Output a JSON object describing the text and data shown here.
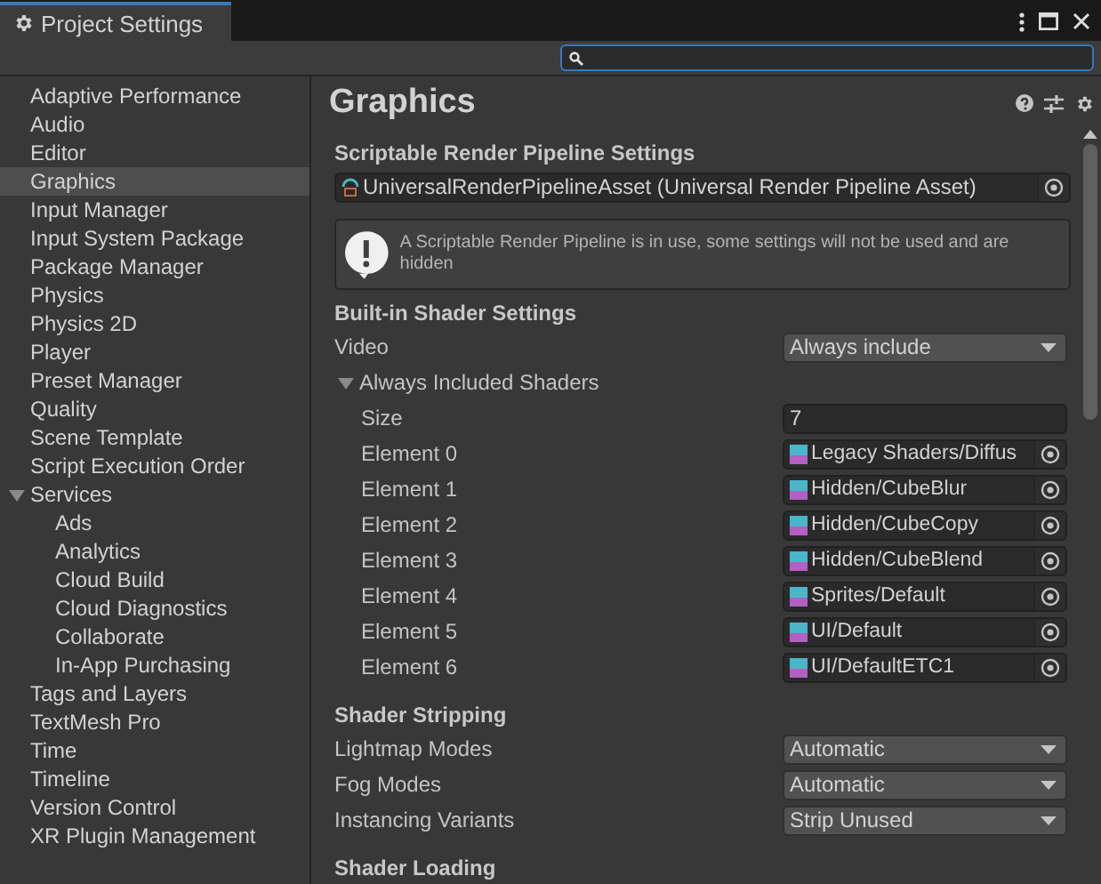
{
  "window": {
    "title": "Project Settings"
  },
  "sidebar": {
    "items": [
      {
        "label": "Adaptive Performance",
        "selected": false
      },
      {
        "label": "Audio",
        "selected": false
      },
      {
        "label": "Editor",
        "selected": false
      },
      {
        "label": "Graphics",
        "selected": true
      },
      {
        "label": "Input Manager",
        "selected": false
      },
      {
        "label": "Input System Package",
        "selected": false
      },
      {
        "label": "Package Manager",
        "selected": false
      },
      {
        "label": "Physics",
        "selected": false
      },
      {
        "label": "Physics 2D",
        "selected": false
      },
      {
        "label": "Player",
        "selected": false
      },
      {
        "label": "Preset Manager",
        "selected": false
      },
      {
        "label": "Quality",
        "selected": false
      },
      {
        "label": "Scene Template",
        "selected": false
      },
      {
        "label": "Script Execution Order",
        "selected": false
      },
      {
        "label": "Services",
        "selected": false,
        "expanded": true,
        "children": [
          {
            "label": "Ads",
            "selected": false
          },
          {
            "label": "Analytics",
            "selected": false
          },
          {
            "label": "Cloud Build",
            "selected": false
          },
          {
            "label": "Cloud Diagnostics",
            "selected": false
          },
          {
            "label": "Collaborate",
            "selected": false
          },
          {
            "label": "In-App Purchasing",
            "selected": false
          }
        ]
      },
      {
        "label": "Tags and Layers",
        "selected": false
      },
      {
        "label": "TextMesh Pro",
        "selected": false
      },
      {
        "label": "Time",
        "selected": false
      },
      {
        "label": "Timeline",
        "selected": false
      },
      {
        "label": "Version Control",
        "selected": false
      },
      {
        "label": "XR Plugin Management",
        "selected": false
      }
    ]
  },
  "panel": {
    "title": "Graphics",
    "sections": [
      {
        "heading": "Scriptable Render Pipeline Settings",
        "rows": [
          {
            "kind": "asset",
            "value": "UniversalRenderPipelineAsset (Universal Render Pipeline Asset)"
          },
          {
            "kind": "warning",
            "text": "A Scriptable Render Pipeline is in use, some settings will not be used and are hidden"
          }
        ]
      },
      {
        "heading": "Built-in Shader Settings",
        "rows": [
          {
            "kind": "dropdown",
            "label": "Video",
            "value": "Always include"
          },
          {
            "kind": "foldout",
            "label": "Always Included Shaders",
            "expanded": true,
            "children": [
              {
                "kind": "number",
                "label": "Size",
                "value": "7"
              },
              {
                "kind": "object",
                "label": "Element 0",
                "value": "Legacy Shaders/Diffus"
              },
              {
                "kind": "object",
                "label": "Element 1",
                "value": "Hidden/CubeBlur"
              },
              {
                "kind": "object",
                "label": "Element 2",
                "value": "Hidden/CubeCopy"
              },
              {
                "kind": "object",
                "label": "Element 3",
                "value": "Hidden/CubeBlend"
              },
              {
                "kind": "object",
                "label": "Element 4",
                "value": "Sprites/Default"
              },
              {
                "kind": "object",
                "label": "Element 5",
                "value": "UI/Default"
              },
              {
                "kind": "object",
                "label": "Element 6",
                "value": "UI/DefaultETC1"
              }
            ]
          }
        ]
      },
      {
        "heading": "Shader Stripping",
        "rows": [
          {
            "kind": "dropdown",
            "label": "Lightmap Modes",
            "value": "Automatic"
          },
          {
            "kind": "dropdown",
            "label": "Fog Modes",
            "value": "Automatic"
          },
          {
            "kind": "dropdown",
            "label": "Instancing Variants",
            "value": "Strip Unused"
          }
        ]
      },
      {
        "heading": "Shader Loading"
      }
    ]
  }
}
